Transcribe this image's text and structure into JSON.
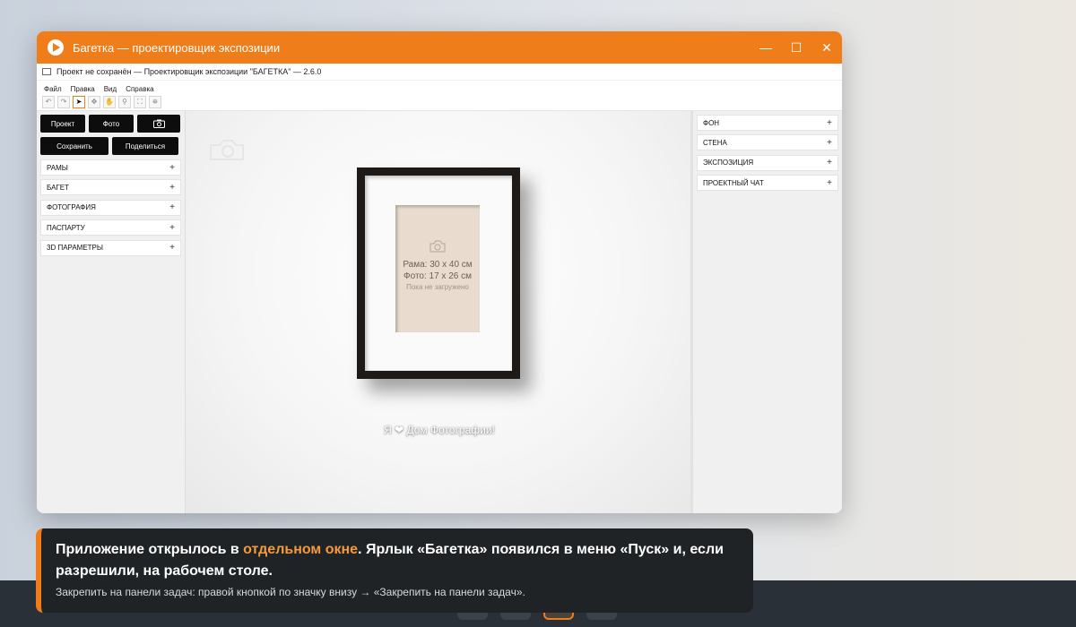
{
  "window": {
    "title": "Багетка — проектировщик экспозиции",
    "subtitle": "Проект не сохранён — Проектировщик экспозиции \"БАГЕТКА\"  — 2.6.0",
    "controls": {
      "minimize": "—",
      "maximize": "☐",
      "close": "✕"
    }
  },
  "menu": [
    "Файл",
    "Правка",
    "Вид",
    "Справка"
  ],
  "toolbar": [
    "↶",
    "↷",
    "➤",
    "✥",
    "✋",
    "⚲",
    "⛶",
    "⛯"
  ],
  "left_panel": {
    "buttons": {
      "project": "Проект",
      "photo": "Фото",
      "save": "Сохранить",
      "share": "Поделиться"
    },
    "sections": [
      "РАМЫ",
      "БАГЕТ",
      "ФОТОГРАФИЯ",
      "ПАСПАРТУ",
      "3D ПАРАМЕТРЫ"
    ]
  },
  "canvas": {
    "frame_size": "Рама: 30 x 40 см",
    "photo_size": "Фото: 17 x 26 см",
    "photo_status": "Пока не загружено",
    "slogan": "Я ❤ Дом Фотографии!"
  },
  "right_panel": {
    "sections": [
      "ФОН",
      "СТЕНА",
      "ЭКСПОЗИЦИЯ",
      "ПРОЕКТНЫЙ ЧАТ"
    ]
  },
  "plus": "+",
  "toast": {
    "text_before": "Приложение открылось в ",
    "text_highlight": "отдельном окне",
    "text_after": ". Ярлык «Багетка» появился в меню «Пуск» и, если разрешили, на рабочем столе.",
    "hint": "Закрепить на панели задач: правой кнопкой по значку внизу → «Закрепить на панели задач»."
  },
  "colors": {
    "accent": "#ef7d1a",
    "highlight": "#f59a3a"
  }
}
